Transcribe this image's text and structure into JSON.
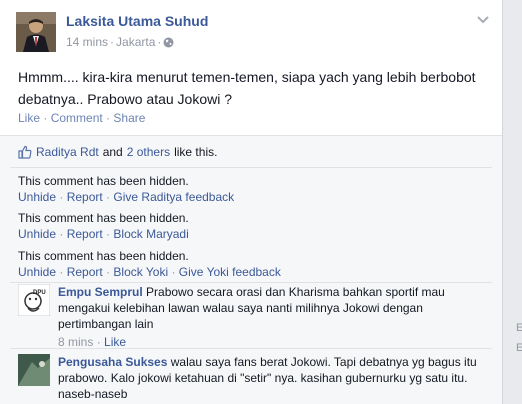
{
  "post": {
    "author": "Laksita Utama Suhud",
    "time": "14 mins",
    "separator": "·",
    "location": "Jakarta",
    "text": "Hmmm.... kira-kira menurut temen-temen, siapa yach yang lebih berbobot debatnya.. Prabowo atau Jokowi ?",
    "actions": {
      "like": "Like",
      "comment": "Comment",
      "share": "Share"
    }
  },
  "likes": {
    "user": "Raditya Rdt",
    "and": "and",
    "others": "2 others",
    "suffix": "like this."
  },
  "hidden_comments": [
    {
      "text": "This comment has been hidden.",
      "links": [
        "Unhide",
        "Report",
        "Give Raditya feedback"
      ]
    },
    {
      "text": "This comment has been hidden.",
      "links": [
        "Unhide",
        "Report",
        "Block Maryadi"
      ]
    },
    {
      "text": "This comment has been hidden.",
      "links": [
        "Unhide",
        "Report",
        "Block Yoki",
        "Give Yoki feedback"
      ]
    }
  ],
  "comments": [
    {
      "author": "Empu Semprul",
      "text": "Prabowo secara orasi dan Kharisma bahkan sportif mau mengakui kelebihan lawan walau saya nanti milihnya Jokowi dengan pertimbangan lain",
      "time": "8 mins",
      "like": "Like",
      "avatar_label": "DPU"
    },
    {
      "author": "Pengusaha Sukses",
      "text": "walau saya fans berat Jokowi. Tapi debatnya yg bagus itu prabowo. Kalo jokowi ketahuan di \"setir\" nya. kasihan gubernurku yg satu itu. naseb-naseb"
    }
  ],
  "right_rail": [
    "E",
    "E"
  ],
  "colors": {
    "link": "#3b5998",
    "muted": "#9197a3",
    "ufi_bg": "#f6f7f8",
    "page_bg": "#e9eaed"
  }
}
